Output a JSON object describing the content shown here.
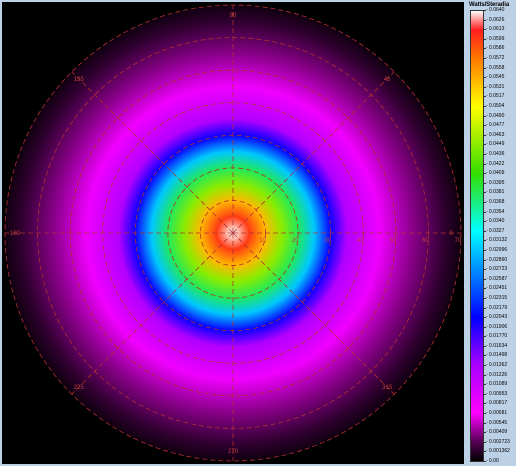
{
  "chart_data": {
    "type": "heatmap",
    "subtype": "polar-radial-intensity",
    "colorbar": {
      "title": "Watts/Steradia",
      "tick_labels": [
        "0.0640",
        "0.0626",
        "0.0613",
        "0.0599",
        "0.0586",
        "0.0572",
        "0.0558",
        "0.0545",
        "0.0531",
        "0.0517",
        "0.0504",
        "0.0490",
        "0.0477",
        "0.0463",
        "0.0449",
        "0.0436",
        "0.0422",
        "0.0409",
        "0.0395",
        "0.0381",
        "0.0368",
        "0.0354",
        "0.0340",
        "0.0327",
        "0.03132",
        "0.02996",
        "0.02860",
        "0.02723",
        "0.02587",
        "0.02451",
        "0.02315",
        "0.02179",
        "0.02043",
        "0.01906",
        "0.01770",
        "0.01634",
        "0.01498",
        "0.01362",
        "0.01226",
        "0.01089",
        "0.00953",
        "0.00817",
        "0.00681",
        "0.00545",
        "0.00409",
        "0.002723",
        "0.001362",
        "0.00"
      ],
      "colors": {
        "0.0640": "#ffffff",
        "0.0613": "#ff1e1e",
        "0.0572": "#ff7a00",
        "0.0504": "#ffff00",
        "0.0409": "#33dd00",
        "0.0327": "#00ffff",
        "0.02043": "#0000ff",
        "0.01362": "#aa00ff",
        "0.00681": "#ff00ff",
        "0.002723": "#550055",
        "0.00": "#000000"
      }
    },
    "radial_tick_labels": [
      "10",
      "20",
      "30",
      "40",
      "50",
      "60",
      "70"
    ],
    "angle_labels": [
      {
        "angle": 0,
        "label": "0"
      },
      {
        "angle": 45,
        "label": "45"
      },
      {
        "angle": 90,
        "label": "90"
      },
      {
        "angle": 135,
        "label": "135"
      },
      {
        "angle": 180,
        "label": "180"
      },
      {
        "angle": 225,
        "label": "225"
      },
      {
        "angle": 270,
        "label": "270"
      },
      {
        "angle": 315,
        "label": "315"
      }
    ],
    "max_radius": 70,
    "peak_value": 0.064,
    "profile": [
      {
        "r": 0,
        "value": 0.064
      },
      {
        "r": 5,
        "value": 0.06
      },
      {
        "r": 10,
        "value": 0.054
      },
      {
        "r": 15,
        "value": 0.045
      },
      {
        "r": 20,
        "value": 0.038
      },
      {
        "r": 25,
        "value": 0.03
      },
      {
        "r": 30,
        "value": 0.02
      },
      {
        "r": 35,
        "value": 0.013
      },
      {
        "r": 45,
        "value": 0.008
      },
      {
        "r": 55,
        "value": 0.004
      },
      {
        "r": 65,
        "value": 0.0015
      },
      {
        "r": 70,
        "value": 0.0005
      }
    ],
    "grid": true
  }
}
